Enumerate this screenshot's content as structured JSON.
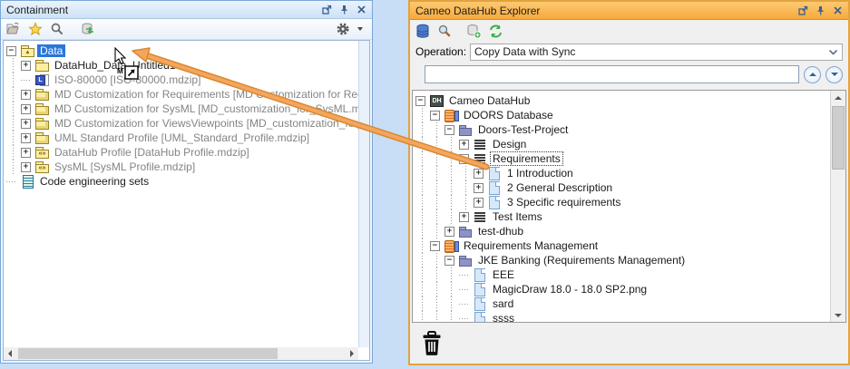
{
  "colors": {
    "selection": "#2a76d9",
    "right_titlebar": "#f7a93a",
    "left_titlebar": "#cde1f6",
    "arrow": "#f4a65e",
    "arrow_outline": "#d9882f"
  },
  "left_panel": {
    "title": "Containment",
    "window_buttons": [
      "float",
      "pin",
      "close"
    ],
    "toolbar_icons": [
      "open-project",
      "favorites",
      "search",
      "datahub-sync",
      "options-gear"
    ],
    "tree": {
      "rows": [
        {
          "text": "Data",
          "depth": 0,
          "exp": "minus",
          "icon": "model",
          "state": "selected"
        },
        {
          "text": "DataHub_Data_Untitled1",
          "depth": 1,
          "exp": "plus",
          "icon": "package"
        },
        {
          "text": "ISO-80000 [ISO-80000.mdzip]",
          "depth": 1,
          "exp": "none",
          "icon": "module",
          "gray": true
        },
        {
          "text": "MD Customization for Requirements [MD Customization for Requiremen",
          "depth": 1,
          "exp": "plus",
          "icon": "shared-package",
          "gray": true
        },
        {
          "text": "MD Customization for SysML [MD_customization_for_SysML.mdzip]",
          "depth": 1,
          "exp": "plus",
          "icon": "shared-package",
          "gray": true
        },
        {
          "text": "MD Customization for ViewsViewpoints [MD_customization_for_ViewsVi",
          "depth": 1,
          "exp": "plus",
          "icon": "shared-package",
          "gray": true
        },
        {
          "text": "UML Standard Profile [UML_Standard_Profile.mdzip]",
          "depth": 1,
          "exp": "plus",
          "icon": "shared-package",
          "gray": true
        },
        {
          "text": "DataHub Profile [DataHub Profile.mdzip]",
          "depth": 1,
          "exp": "plus",
          "icon": "profile",
          "gray": true
        },
        {
          "text": "SysML [SysML Profile.mdzip]",
          "depth": 1,
          "exp": "plus",
          "icon": "profile",
          "gray": true
        },
        {
          "text": "Code engineering sets",
          "depth": 0,
          "exp": "none",
          "icon": "code-engineering"
        }
      ]
    }
  },
  "right_panel": {
    "title": "Cameo DataHub Explorer",
    "window_buttons": [
      "float",
      "pin",
      "close"
    ],
    "toolbar_icons": [
      "datahub-database",
      "search",
      "add-data-source",
      "refresh"
    ],
    "operation_label": "Operation:",
    "operation_value": "Copy Data with Sync",
    "search_value": "",
    "tree": {
      "rows": [
        {
          "text": "Cameo DataHub",
          "depth": 0,
          "exp": "minus",
          "icon": "datahub-root"
        },
        {
          "text": "DOORS Database",
          "depth": 1,
          "exp": "minus",
          "icon": "database"
        },
        {
          "text": "Doors-Test-Project",
          "depth": 2,
          "exp": "minus",
          "icon": "folder"
        },
        {
          "text": "Design",
          "depth": 3,
          "exp": "plus",
          "icon": "specification"
        },
        {
          "text": "Requirements",
          "depth": 3,
          "exp": "minus",
          "icon": "specification",
          "state": "focused"
        },
        {
          "text": "1 Introduction",
          "depth": 4,
          "exp": "plus",
          "icon": "document"
        },
        {
          "text": "2 General Description",
          "depth": 4,
          "exp": "plus",
          "icon": "document"
        },
        {
          "text": "3 Specific requirements",
          "depth": 4,
          "exp": "plus",
          "icon": "document"
        },
        {
          "text": "Test Items",
          "depth": 3,
          "exp": "plus",
          "icon": "specification"
        },
        {
          "text": "test-dhub",
          "depth": 2,
          "exp": "plus",
          "icon": "folder"
        },
        {
          "text": "Requirements Management",
          "depth": 1,
          "exp": "minus",
          "icon": "database"
        },
        {
          "text": "JKE Banking (Requirements Management)",
          "depth": 2,
          "exp": "minus",
          "icon": "folder"
        },
        {
          "text": "EEE",
          "depth": 3,
          "exp": "none",
          "icon": "document"
        },
        {
          "text": "MagicDraw 18.0 - 18.0 SP2.png",
          "depth": 3,
          "exp": "none",
          "icon": "document"
        },
        {
          "text": "sard",
          "depth": 3,
          "exp": "none",
          "icon": "document"
        },
        {
          "text": "ssss",
          "depth": 3,
          "exp": "none",
          "icon": "document"
        }
      ]
    },
    "footer_icons": [
      "trash"
    ]
  },
  "drag_overlay": {
    "badge_letter": "M",
    "description": "drag from Requirements to Data"
  }
}
